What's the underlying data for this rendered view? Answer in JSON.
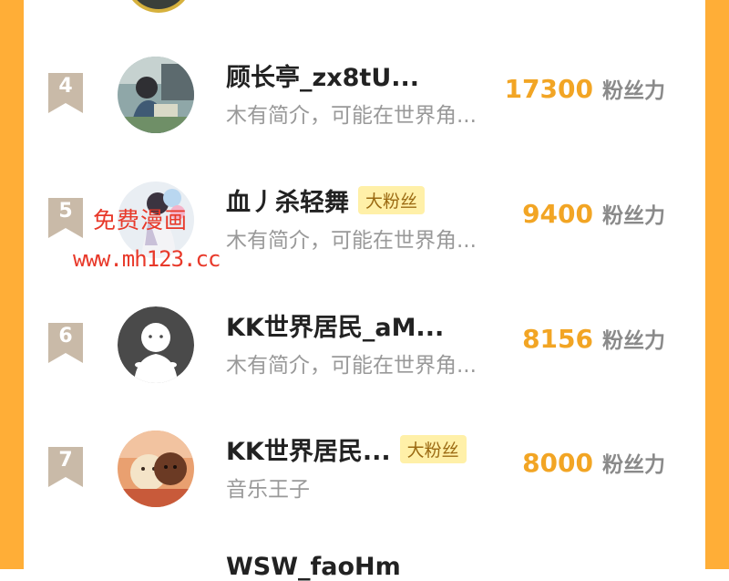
{
  "leaderboard": {
    "fans_unit": "粉丝力",
    "rows": [
      {
        "rank": "4",
        "name": "顾长亭_zx8tU...",
        "badge": "",
        "description": "木有简介，可能在世界角...",
        "fans": "17300"
      },
      {
        "rank": "5",
        "name": "血丿杀轻舞",
        "badge": "大粉丝",
        "description": "木有简介，可能在世界角...",
        "fans": "9400"
      },
      {
        "rank": "6",
        "name": "KK世界居民_aM...",
        "badge": "",
        "description": "木有简介，可能在世界角...",
        "fans": "8156"
      },
      {
        "rank": "7",
        "name": "KK世界居民...",
        "badge": "大粉丝",
        "description": "音乐王子",
        "fans": "8000"
      }
    ],
    "next_row_name": "WSW_faoHm"
  },
  "watermark": {
    "line1": "免费漫画",
    "line2": "www.mh123.cc"
  },
  "colors": {
    "accent": "#F2A524",
    "frame": "#FFAE37",
    "badge_bg": "#FFF0A8",
    "rank_badge": "#C9BAA8",
    "watermark": "#E8392A"
  },
  "icons": {
    "rank": "ribbon-flag-icon",
    "default_avatar": "default-avatar-icon"
  }
}
